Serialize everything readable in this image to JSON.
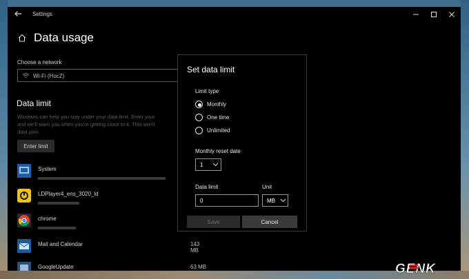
{
  "window": {
    "title": "Settings"
  },
  "page": {
    "title": "Data usage"
  },
  "network": {
    "label": "Choose a network",
    "selected": "Wi-Fi (HocZ)"
  },
  "data_limit_section": {
    "title": "Data limit",
    "description": [
      "Windows can help you stay under your data limit. Enter your",
      "and we'll warn you when you're getting close to it. This won't",
      "data plan."
    ],
    "button": "Enter limit"
  },
  "apps": [
    {
      "name": "System",
      "usage": "",
      "bar": 0.78,
      "icon": "system-icon"
    },
    {
      "name": "LDPlayer4_ens_3020_ld",
      "usage": "",
      "bar": 0.22,
      "icon": "ldplayer-icon"
    },
    {
      "name": "chrome",
      "usage": "",
      "bar": 0.18,
      "icon": "chrome-icon"
    },
    {
      "name": "Mail and Calendar",
      "usage": "143 MB",
      "bar": 0,
      "icon": "mail-calendar-icon"
    },
    {
      "name": "GoogleUpdate",
      "usage": "63 MB",
      "bar": 0,
      "icon": "google-update-icon"
    }
  ],
  "dialog": {
    "title": "Set data limit",
    "limit_type_label": "Limit type",
    "options": [
      "Monthly",
      "One time",
      "Unlimited"
    ],
    "selected_option": "Monthly",
    "reset_label": "Monthly reset date",
    "reset_value": "1",
    "data_limit_label": "Data limit",
    "data_limit_value": "0",
    "unit_label": "Unit",
    "unit_value": "MB",
    "save": "Save",
    "cancel": "Cancel"
  },
  "watermark": {
    "text": "GENK"
  }
}
